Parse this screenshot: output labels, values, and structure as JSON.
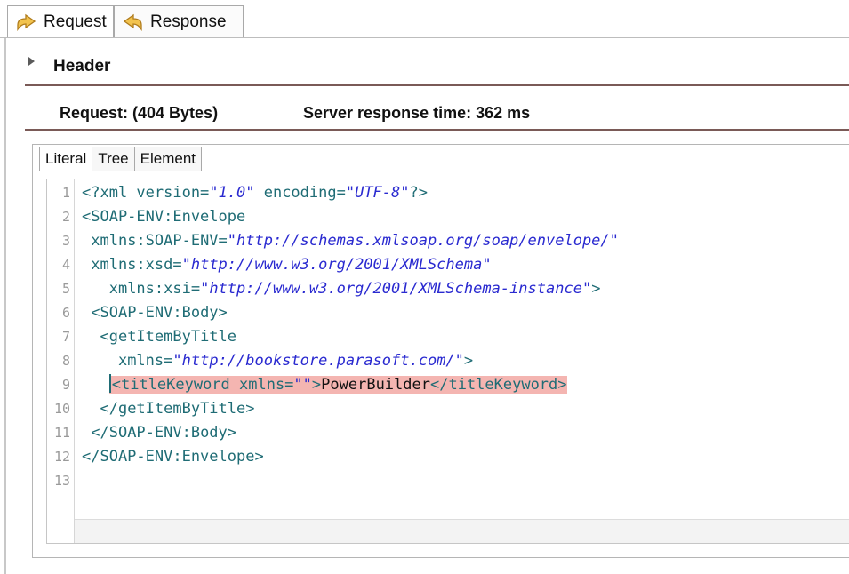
{
  "tabs": [
    {
      "label": "Request",
      "icon": "request-arrow-icon",
      "active": true
    },
    {
      "label": "Response",
      "icon": "response-arrow-icon",
      "active": false
    }
  ],
  "header": {
    "title": "Header"
  },
  "info": {
    "request": "Request:  (404 Bytes)",
    "server": "Server response time: 362 ms"
  },
  "view_tabs": [
    {
      "label": "Literal",
      "active": true
    },
    {
      "label": "Tree",
      "active": false
    },
    {
      "label": "Element",
      "active": false
    }
  ],
  "editor": {
    "lines": [
      {
        "n": "1",
        "indent": "",
        "segs": [
          [
            "tag",
            "<?xml version="
          ],
          [
            "str",
            "\"1.0\""
          ],
          [
            "tag",
            " encoding="
          ],
          [
            "str",
            "\"UTF-8\""
          ],
          [
            "tag",
            "?>"
          ]
        ]
      },
      {
        "n": "2",
        "indent": "",
        "segs": [
          [
            "tag",
            "<SOAP-ENV:Envelope"
          ]
        ]
      },
      {
        "n": "3",
        "indent": " ",
        "segs": [
          [
            "tag",
            "xmlns:SOAP-ENV="
          ],
          [
            "str",
            "\"http://schemas.xmlsoap.org/soap/envelope/\""
          ]
        ]
      },
      {
        "n": "4",
        "indent": " ",
        "segs": [
          [
            "tag",
            "xmlns:xsd="
          ],
          [
            "str",
            "\"http://www.w3.org/2001/XMLSchema\""
          ]
        ]
      },
      {
        "n": "5",
        "indent": "   ",
        "segs": [
          [
            "tag",
            "xmlns:xsi="
          ],
          [
            "str",
            "\"http://www.w3.org/2001/XMLSchema-instance\""
          ],
          [
            "tag",
            ">"
          ]
        ]
      },
      {
        "n": "6",
        "indent": " ",
        "segs": [
          [
            "tag",
            "<SOAP-ENV:Body>"
          ]
        ]
      },
      {
        "n": "7",
        "indent": "  ",
        "segs": [
          [
            "tag",
            "<getItemByTitle"
          ]
        ]
      },
      {
        "n": "8",
        "indent": "    ",
        "segs": [
          [
            "tag",
            "xmlns="
          ],
          [
            "str",
            "\"http://bookstore.parasoft.com/\""
          ],
          [
            "tag",
            ">"
          ]
        ]
      },
      {
        "n": "9",
        "indent": "   ",
        "highlight": true,
        "segs": [
          [
            "tag",
            "<titleKeyword xmlns="
          ],
          [
            "str",
            "\"\""
          ],
          [
            "tag",
            ">"
          ],
          [
            "txt",
            "PowerBuilder"
          ],
          [
            "tag",
            "</titleKeyword>"
          ]
        ]
      },
      {
        "n": "10",
        "indent": "  ",
        "segs": [
          [
            "tag",
            "</getItemByTitle>"
          ]
        ]
      },
      {
        "n": "11",
        "indent": " ",
        "segs": [
          [
            "tag",
            "</SOAP-ENV:Body>"
          ]
        ]
      },
      {
        "n": "12",
        "indent": "",
        "segs": [
          [
            "tag",
            "</SOAP-ENV:Envelope>"
          ]
        ]
      },
      {
        "n": "13",
        "indent": "",
        "segs": []
      }
    ]
  },
  "colors": {
    "tag": "#1f6c75",
    "string": "#2a2ad0",
    "highlight": "#f4b5b1",
    "separator": "#7a5a57"
  }
}
